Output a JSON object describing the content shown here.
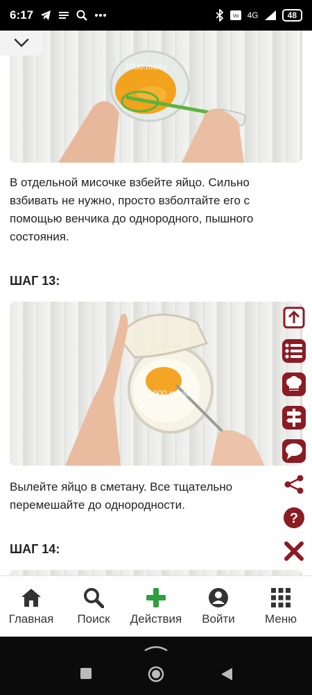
{
  "status_bar": {
    "time": "6:17",
    "network": "4G",
    "battery": "48"
  },
  "steps": [
    {
      "text": "В отдельной мисочке взбейте яйцо. Сильно взбивать не нужно, просто взболтайте его с помощью венчика до однородного, пышного состояния."
    },
    {
      "title": "ШАГ 13:",
      "text": "Вылейте яйцо в сметану. Все тщательно перемешайте до однородности."
    },
    {
      "title": "ШАГ 14:"
    }
  ],
  "watermark": "1000.menu",
  "side_tools": [
    {
      "icon": "scroll-top-icon"
    },
    {
      "icon": "ingredients-list-icon"
    },
    {
      "icon": "chef-hat-icon"
    },
    {
      "icon": "signpost-icon"
    },
    {
      "icon": "comment-icon"
    },
    {
      "icon": "share-icon"
    },
    {
      "icon": "help-icon"
    },
    {
      "icon": "close-icon"
    }
  ],
  "bottom_nav": [
    {
      "label": "Главная",
      "icon": "home-icon"
    },
    {
      "label": "Поиск",
      "icon": "search-icon"
    },
    {
      "label": "Действия",
      "icon": "plus-icon"
    },
    {
      "label": "Войти",
      "icon": "user-icon"
    },
    {
      "label": "Меню",
      "icon": "grid-menu-icon"
    }
  ],
  "colors": {
    "brand": "#8a1c24",
    "action_green": "#2e9e3f",
    "nav_icon": "#333333"
  }
}
